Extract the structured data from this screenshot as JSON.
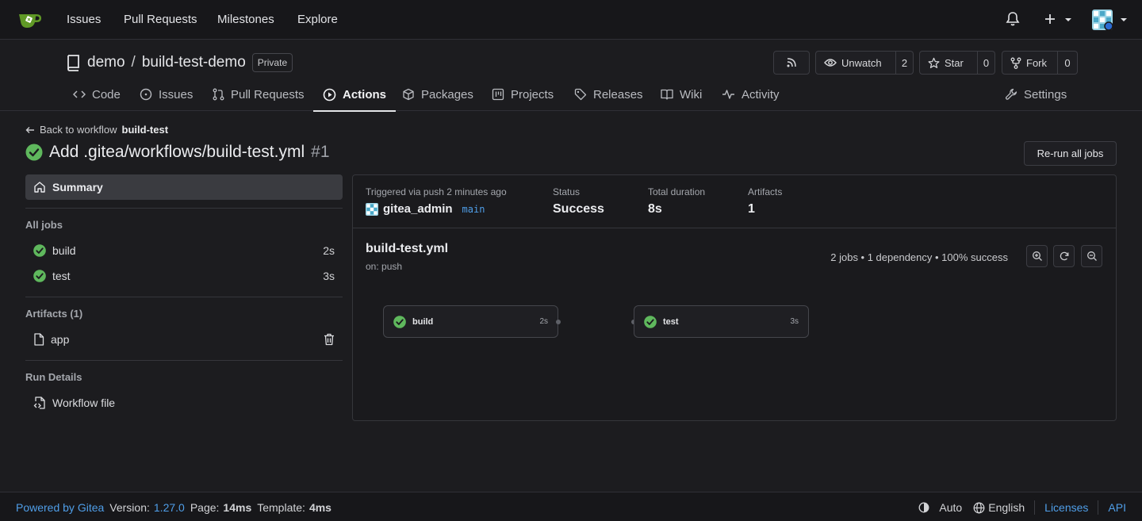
{
  "navbar": {
    "items": [
      "Issues",
      "Pull Requests",
      "Milestones",
      "Explore"
    ]
  },
  "repo": {
    "owner": "demo",
    "separator": "/",
    "name": "build-test-demo",
    "visibility": "Private",
    "unwatch_label": "Unwatch",
    "watch_count": "2",
    "star_label": "Star",
    "star_count": "0",
    "fork_label": "Fork",
    "fork_count": "0"
  },
  "tabs": {
    "code": "Code",
    "issues": "Issues",
    "pull_requests": "Pull Requests",
    "actions": "Actions",
    "packages": "Packages",
    "projects": "Projects",
    "releases": "Releases",
    "wiki": "Wiki",
    "activity": "Activity",
    "settings": "Settings"
  },
  "run": {
    "back_prefix": "Back to workflow",
    "back_workflow": "build-test",
    "title": "Add .gitea/workflows/build-test.yml",
    "number": "#1",
    "rerun_label": "Re-run all jobs"
  },
  "sidebar": {
    "summary": "Summary",
    "all_jobs_heading": "All jobs",
    "jobs": [
      {
        "name": "build",
        "duration": "2s"
      },
      {
        "name": "test",
        "duration": "3s"
      }
    ],
    "artifacts_heading": "Artifacts (1)",
    "artifact_name": "app",
    "run_details_heading": "Run Details",
    "workflow_file": "Workflow file"
  },
  "summary": {
    "triggered_label": "Triggered via push 2 minutes ago",
    "user": "gitea_admin",
    "branch": "main",
    "status_label": "Status",
    "status_value": "Success",
    "duration_label": "Total duration",
    "duration_value": "8s",
    "artifacts_label": "Artifacts",
    "artifacts_value": "1"
  },
  "workflow": {
    "name": "build-test.yml",
    "trigger": "on: push",
    "stats": "2 jobs • 1 dependency • 100% success",
    "nodes": [
      {
        "name": "build",
        "duration": "2s"
      },
      {
        "name": "test",
        "duration": "3s"
      }
    ]
  },
  "footer": {
    "powered": "Powered by Gitea",
    "version_label": "Version:",
    "version": "1.27.0",
    "page_label": "Page:",
    "page_time": "14ms",
    "template_label": "Template:",
    "template_time": "4ms",
    "theme": "Auto",
    "language": "English",
    "licenses": "Licenses",
    "api": "API"
  },
  "colors": {
    "success": "#5fb85d",
    "link": "#4f9ee8"
  }
}
